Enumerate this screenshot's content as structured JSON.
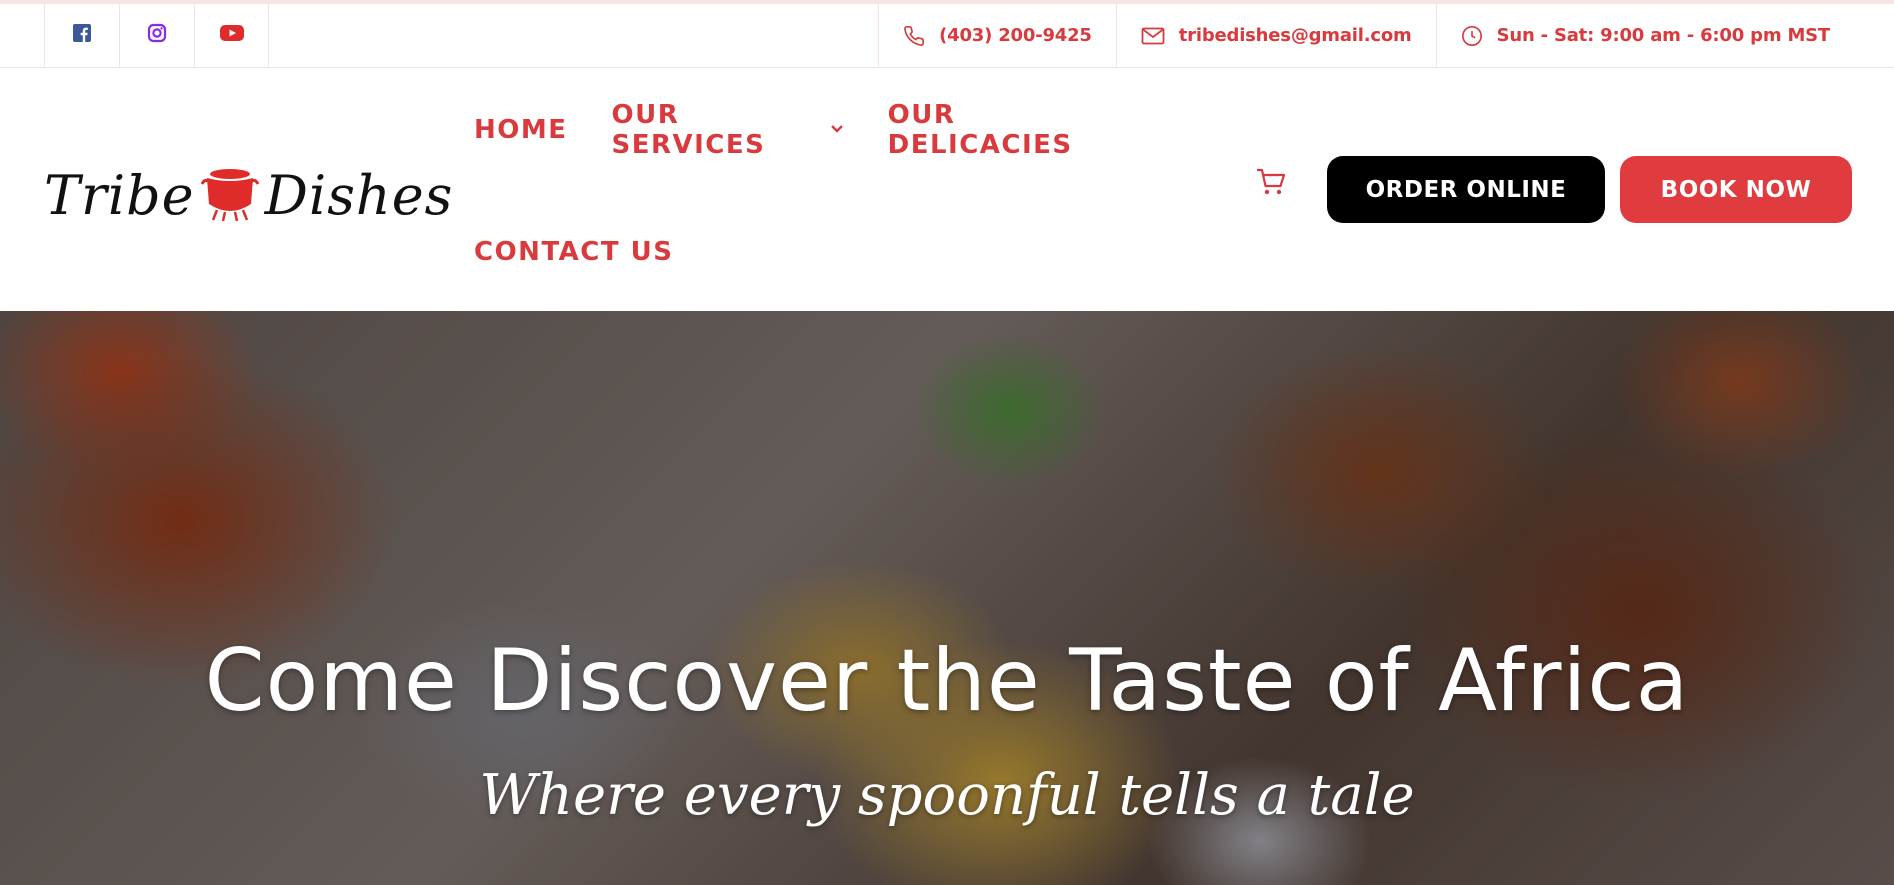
{
  "topbar": {
    "socials": [
      {
        "icon": "facebook-icon",
        "color": "#3b5998"
      },
      {
        "icon": "instagram-icon",
        "color": "#8a2be2"
      },
      {
        "icon": "youtube-icon",
        "color": "#e02b2b"
      }
    ],
    "phone": "(403) 200-9425",
    "email": "tribedishes@gmail.com",
    "hours": "Sun - Sat: 9:00 am - 6:00 pm MST"
  },
  "header": {
    "logo_left": "Tribe",
    "logo_right": "Dishes",
    "nav": {
      "home": "HOME",
      "services": "OUR SERVICES",
      "delicacies": "OUR DELICACIES",
      "contact": "CONTACT US"
    },
    "order_label": "ORDER ONLINE",
    "book_label": "BOOK NOW"
  },
  "hero": {
    "title": "Come Discover the Taste of Africa",
    "subtitle": "Where every spoonful tells a tale"
  },
  "colors": {
    "accent": "#d93a3e",
    "book_button": "#e03b3e",
    "order_button": "#000000"
  }
}
